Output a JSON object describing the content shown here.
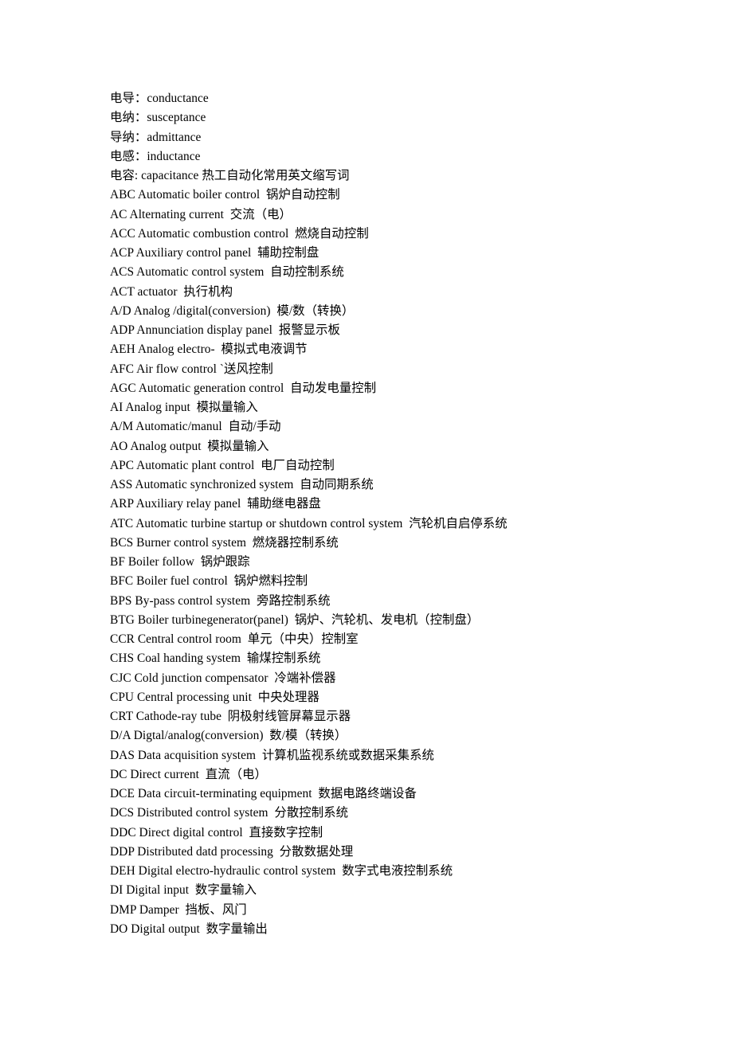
{
  "document": {
    "background_color": "#ffffff",
    "text_color": "#000000",
    "lines": [
      {
        "id": "line-1",
        "text": "电导：conductance"
      },
      {
        "id": "line-2",
        "text": "电纳：susceptance"
      },
      {
        "id": "line-3",
        "text": "导纳：admittance"
      },
      {
        "id": "line-4",
        "text": "电感：inductance"
      },
      {
        "id": "line-5",
        "text": "电容: capacitance 热工自动化常用英文缩写词"
      },
      {
        "id": "line-6",
        "text": "ABC Automatic boiler control  锅炉自动控制"
      },
      {
        "id": "line-7",
        "text": "AC Alternating current  交流（电）"
      },
      {
        "id": "line-8",
        "text": "ACC Automatic combustion control  燃烧自动控制"
      },
      {
        "id": "line-9",
        "text": "ACP Auxiliary control panel  辅助控制盘"
      },
      {
        "id": "line-10",
        "text": "ACS Automatic control system  自动控制系统"
      },
      {
        "id": "line-11",
        "text": "ACT actuator  执行机构"
      },
      {
        "id": "line-12",
        "text": "A/D Analog /digital(conversion)  模/数（转换）"
      },
      {
        "id": "line-13",
        "text": "ADP Annunciation display panel  报警显示板"
      },
      {
        "id": "line-14",
        "text": "AEH Analog electro-  模拟式电液调节"
      },
      {
        "id": "line-15",
        "text": "AFC Air flow control `送风控制"
      },
      {
        "id": "line-16",
        "text": "AGC Automatic generation control  自动发电量控制"
      },
      {
        "id": "line-17",
        "text": "AI Analog input  模拟量输入"
      },
      {
        "id": "line-18",
        "text": "A/M Automatic/manul  自动/手动"
      },
      {
        "id": "line-19",
        "text": "AO Analog output  模拟量输入"
      },
      {
        "id": "line-20",
        "text": "APC Automatic plant control  电厂自动控制"
      },
      {
        "id": "line-21",
        "text": "ASS Automatic synchronized system  自动同期系统"
      },
      {
        "id": "line-22",
        "text": "ARP Auxiliary relay panel  辅助继电器盘"
      },
      {
        "id": "line-23",
        "text": "ATC Automatic turbine startup or shutdown control system  汽轮机自启停系统"
      },
      {
        "id": "line-24",
        "text": "BCS Burner control system  燃烧器控制系统"
      },
      {
        "id": "line-25",
        "text": "BF Boiler follow  锅炉跟踪"
      },
      {
        "id": "line-26",
        "text": "BFC Boiler fuel control  锅炉燃料控制"
      },
      {
        "id": "line-27",
        "text": "BPS By-pass control system  旁路控制系统"
      },
      {
        "id": "line-28",
        "text": "BTG Boiler turbinegenerator(panel)  锅炉、汽轮机、发电机（控制盘）"
      },
      {
        "id": "line-29",
        "text": "CCR Central control room  单元（中央）控制室"
      },
      {
        "id": "line-30",
        "text": "CHS Coal handing system  输煤控制系统"
      },
      {
        "id": "line-31",
        "text": "CJC Cold junction compensator  冷端补偿器"
      },
      {
        "id": "line-32",
        "text": "CPU Central processing unit  中央处理器"
      },
      {
        "id": "line-33",
        "text": "CRT Cathode-ray tube  阴极射线管屏幕显示器"
      },
      {
        "id": "line-34",
        "text": "D/A Digtal/analog(conversion)  数/模（转换）"
      },
      {
        "id": "line-35",
        "text": "DAS Data acquisition system  计算机监视系统或数据采集系统"
      },
      {
        "id": "line-36",
        "text": "DC Direct current  直流（电）"
      },
      {
        "id": "line-37",
        "text": "DCE Data circuit-terminating equipment  数据电路终端设备"
      },
      {
        "id": "line-38",
        "text": "DCS Distributed control system  分散控制系统"
      },
      {
        "id": "line-39",
        "text": "DDC Direct digital control  直接数字控制"
      },
      {
        "id": "line-40",
        "text": "DDP Distributed datd processing  分散数据处理"
      },
      {
        "id": "line-41",
        "text": "DEH Digital electro-hydraulic control system  数字式电液控制系统"
      },
      {
        "id": "line-42",
        "text": "DI Digital input  数字量输入"
      },
      {
        "id": "line-43",
        "text": "DMP Damper  挡板、风门"
      },
      {
        "id": "line-44",
        "text": "DO Digital output  数字量输出"
      }
    ]
  }
}
